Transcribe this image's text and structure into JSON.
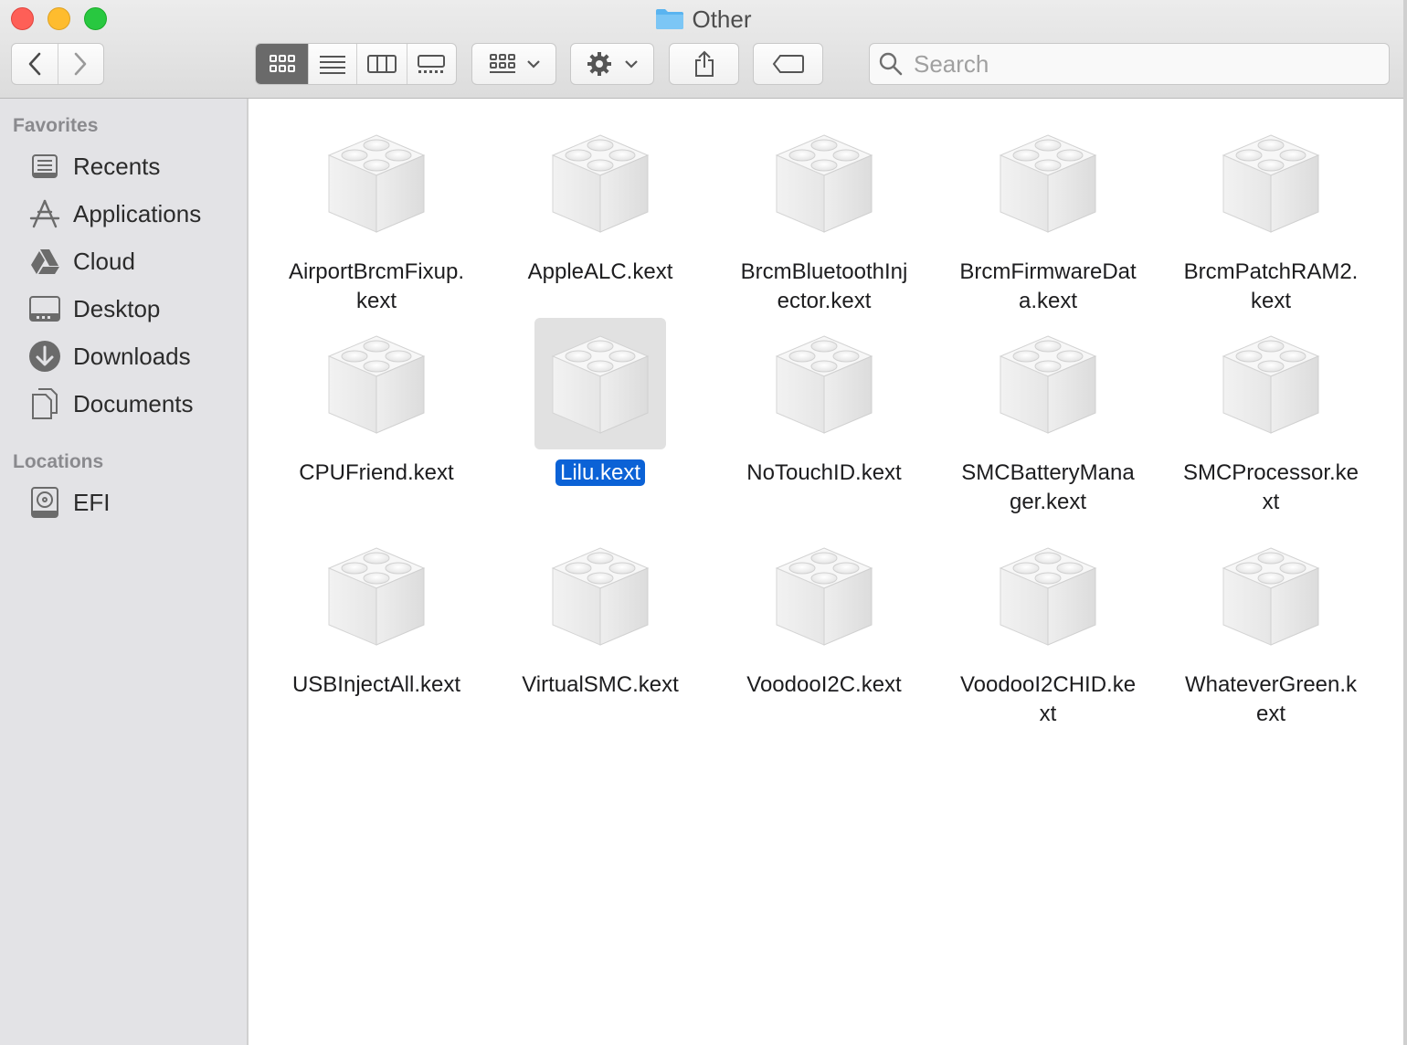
{
  "window": {
    "title": "Other",
    "icon": "folder-icon"
  },
  "toolbar": {
    "back": "chevron-left-icon",
    "forward": "chevron-right-icon",
    "view_modes": [
      "icon-view",
      "list-view",
      "column-view",
      "gallery-view"
    ],
    "active_view": "icon-view",
    "group_button": "group-by-icon",
    "action_button": "gear-icon",
    "share_button": "share-icon",
    "tags_button": "tag-icon",
    "search_placeholder": "Search"
  },
  "sidebar": {
    "favorites_header": "Favorites",
    "favorites": [
      {
        "label": "Recents",
        "icon": "recents-icon"
      },
      {
        "label": "Applications",
        "icon": "applications-icon"
      },
      {
        "label": "Cloud",
        "icon": "cloud-drive-icon"
      },
      {
        "label": "Desktop",
        "icon": "desktop-icon"
      },
      {
        "label": "Downloads",
        "icon": "downloads-icon"
      },
      {
        "label": "Documents",
        "icon": "documents-icon"
      }
    ],
    "locations_header": "Locations",
    "locations": [
      {
        "label": "EFI",
        "icon": "disk-icon"
      }
    ]
  },
  "files": [
    {
      "name": "AirportBrcmFixup.kext",
      "lines": [
        "AirportBrcmFixup.",
        "kext"
      ]
    },
    {
      "name": "AppleALC.kext",
      "lines": [
        "AppleALC.kext"
      ]
    },
    {
      "name": "BrcmBluetoothInjector.kext",
      "lines": [
        "BrcmBluetoothInj",
        "ector.kext"
      ]
    },
    {
      "name": "BrcmFirmwareData.kext",
      "lines": [
        "BrcmFirmwareDat",
        "a.kext"
      ]
    },
    {
      "name": "BrcmPatchRAM2.kext",
      "lines": [
        "BrcmPatchRAM2.",
        "kext"
      ]
    },
    {
      "name": "CPUFriend.kext",
      "lines": [
        "CPUFriend.kext"
      ]
    },
    {
      "name": "Lilu.kext",
      "lines": [
        "Lilu.kext"
      ],
      "selected": true
    },
    {
      "name": "NoTouchID.kext",
      "lines": [
        "NoTouchID.kext"
      ]
    },
    {
      "name": "SMCBatteryManager.kext",
      "lines": [
        "SMCBatteryMana",
        "ger.kext"
      ]
    },
    {
      "name": "SMCProcessor.kext",
      "lines": [
        "SMCProcessor.ke",
        "xt"
      ]
    },
    {
      "name": "USBInjectAll.kext",
      "lines": [
        "USBInjectAll.kext"
      ]
    },
    {
      "name": "VirtualSMC.kext",
      "lines": [
        "VirtualSMC.kext"
      ]
    },
    {
      "name": "VoodooI2C.kext",
      "lines": [
        "VoodooI2C.kext"
      ]
    },
    {
      "name": "VoodooI2CHID.kext",
      "lines": [
        "VoodooI2CHID.ke",
        "xt"
      ]
    },
    {
      "name": "WhateverGreen.kext",
      "lines": [
        "WhateverGreen.k",
        "ext"
      ]
    }
  ],
  "colors": {
    "selection": "#0b62d6",
    "close": "#fe5f57",
    "minimize": "#febc2e",
    "maximize": "#28c840",
    "folder": "#5ab4f0"
  }
}
